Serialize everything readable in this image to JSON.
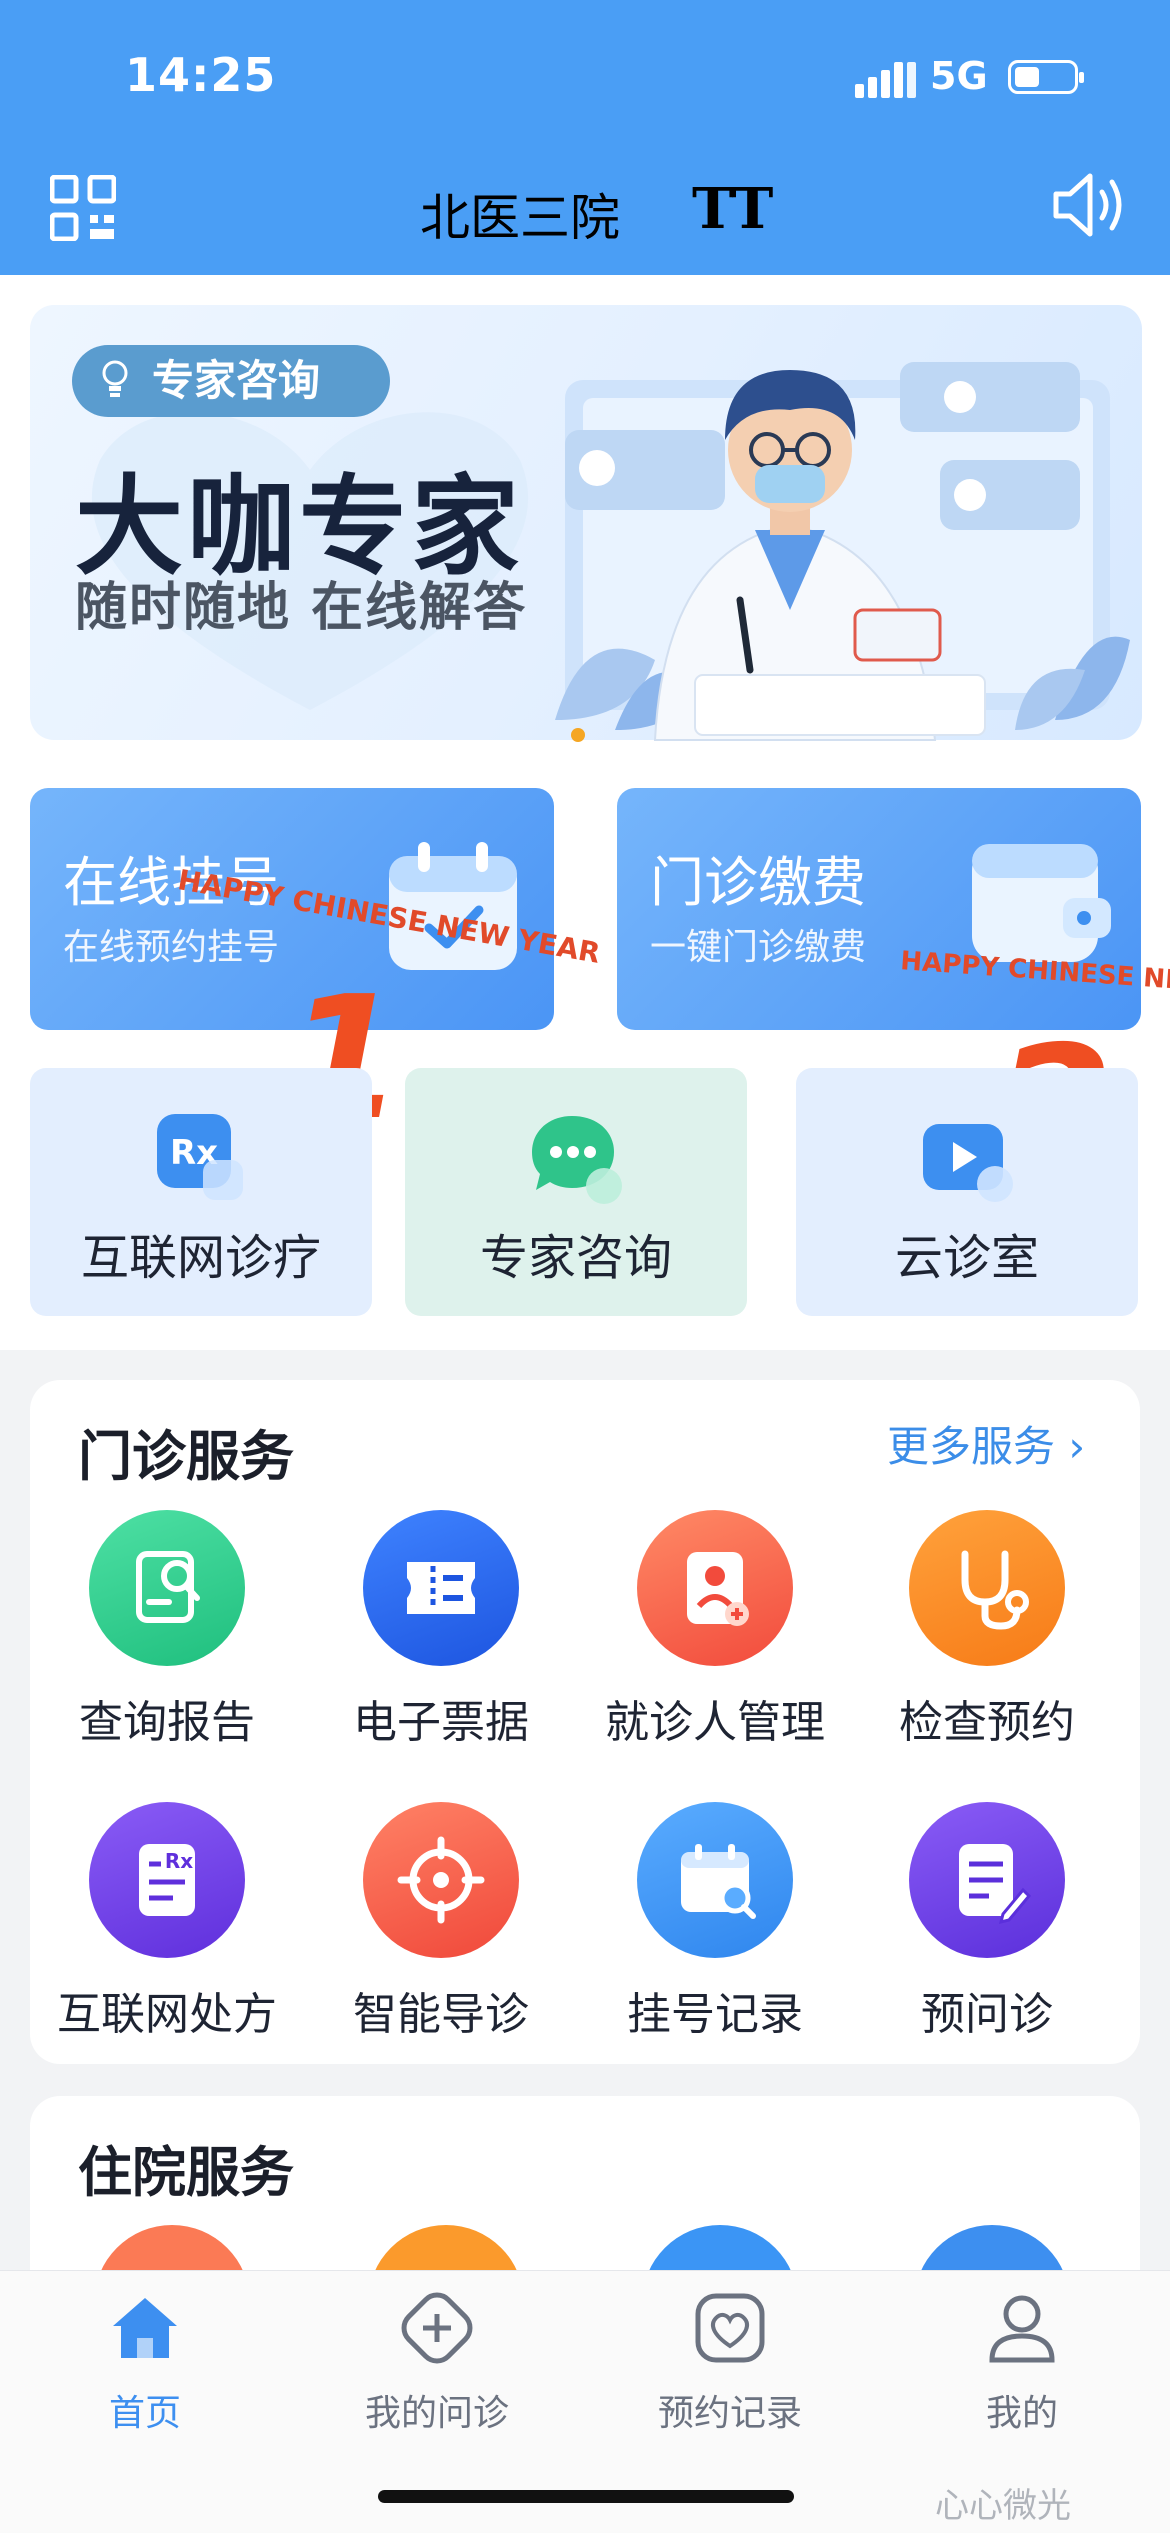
{
  "status": {
    "time": "14:25",
    "network": "5G"
  },
  "navbar": {
    "title": "北医三院",
    "font_size_icon": "TT"
  },
  "banner": {
    "tag": "专家咨询",
    "headline": "大咖专家",
    "subline": "随时随地 在线解答"
  },
  "cards": {
    "register": {
      "title": "在线挂号",
      "subtitle": "在线预约挂号"
    },
    "payment": {
      "title": "门诊缴费",
      "subtitle": "一键门诊缴费"
    },
    "overlay_text": "HAPPY CHINESE NEW YEAR",
    "numbers": [
      "1",
      "2"
    ]
  },
  "quick_services": [
    {
      "label": "互联网诊疗",
      "icon": "rx-icon"
    },
    {
      "label": "专家咨询",
      "icon": "chat-bubble-icon"
    },
    {
      "label": "云诊室",
      "icon": "video-icon"
    }
  ],
  "outpatient": {
    "title": "门诊服务",
    "more": "更多服务 ›",
    "items": [
      {
        "label": "查询报告",
        "icon": "report-search-icon",
        "color": "#2fd08e"
      },
      {
        "label": "电子票据",
        "icon": "ticket-icon",
        "color": "#2d6cf2"
      },
      {
        "label": "就诊人管理",
        "icon": "patient-card-icon",
        "color": "#fb6a4a"
      },
      {
        "label": "检查预约",
        "icon": "stethoscope-icon",
        "color": "#fb8a22"
      },
      {
        "label": "互联网处方",
        "icon": "prescription-icon",
        "color": "#7647e8"
      },
      {
        "label": "智能导诊",
        "icon": "target-icon",
        "color": "#fb6446"
      },
      {
        "label": "挂号记录",
        "icon": "calendar-search-icon",
        "color": "#3b95f5"
      },
      {
        "label": "预问诊",
        "icon": "note-edit-icon",
        "color": "#7545ea"
      }
    ]
  },
  "inpatient": {
    "title": "住院服务"
  },
  "tabbar": [
    {
      "label": "首页",
      "icon": "home-icon",
      "active": true
    },
    {
      "label": "我的问诊",
      "icon": "medical-plus-icon",
      "active": false
    },
    {
      "label": "预约记录",
      "icon": "heart-shield-icon",
      "active": false
    },
    {
      "label": "我的",
      "icon": "user-icon",
      "active": false
    }
  ],
  "watermark": "心心微光",
  "colors": {
    "primary": "#4a9ef5",
    "accent": "#3d8ff0"
  }
}
